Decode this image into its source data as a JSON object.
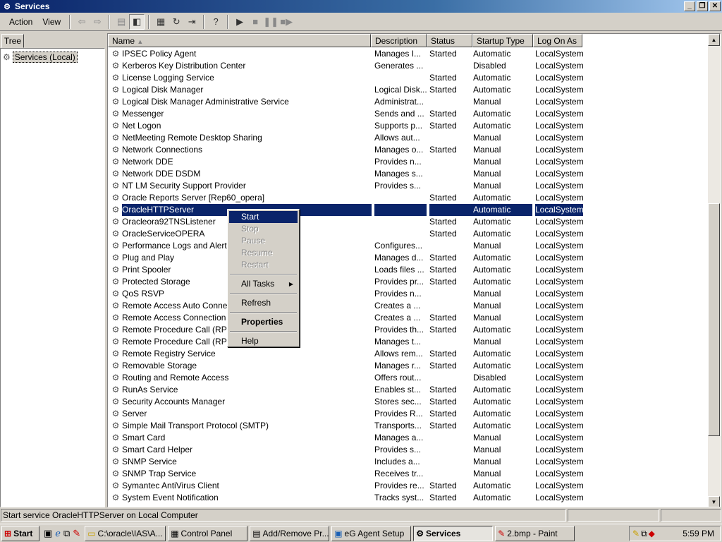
{
  "window": {
    "title": "Services"
  },
  "menubar": {
    "items": [
      {
        "label": "Action"
      },
      {
        "label": "View"
      }
    ]
  },
  "tree": {
    "tab_label": "Tree",
    "root_label": "Services (Local)"
  },
  "list": {
    "columns": [
      "Name",
      "Description",
      "Status",
      "Startup Type",
      "Log On As"
    ],
    "rows": [
      {
        "name": "IPSEC Policy Agent",
        "desc": "Manages I...",
        "status": "Started",
        "type": "Automatic",
        "logon": "LocalSystem"
      },
      {
        "name": "Kerberos Key Distribution Center",
        "desc": "Generates ...",
        "status": "",
        "type": "Disabled",
        "logon": "LocalSystem"
      },
      {
        "name": "License Logging Service",
        "desc": "",
        "status": "Started",
        "type": "Automatic",
        "logon": "LocalSystem"
      },
      {
        "name": "Logical Disk Manager",
        "desc": "Logical Disk...",
        "status": "Started",
        "type": "Automatic",
        "logon": "LocalSystem"
      },
      {
        "name": "Logical Disk Manager Administrative Service",
        "desc": "Administrat...",
        "status": "",
        "type": "Manual",
        "logon": "LocalSystem"
      },
      {
        "name": "Messenger",
        "desc": "Sends and ...",
        "status": "Started",
        "type": "Automatic",
        "logon": "LocalSystem"
      },
      {
        "name": "Net Logon",
        "desc": "Supports p...",
        "status": "Started",
        "type": "Automatic",
        "logon": "LocalSystem"
      },
      {
        "name": "NetMeeting Remote Desktop Sharing",
        "desc": "Allows aut...",
        "status": "",
        "type": "Manual",
        "logon": "LocalSystem"
      },
      {
        "name": "Network Connections",
        "desc": "Manages o...",
        "status": "Started",
        "type": "Manual",
        "logon": "LocalSystem"
      },
      {
        "name": "Network DDE",
        "desc": "Provides n...",
        "status": "",
        "type": "Manual",
        "logon": "LocalSystem"
      },
      {
        "name": "Network DDE DSDM",
        "desc": "Manages s...",
        "status": "",
        "type": "Manual",
        "logon": "LocalSystem"
      },
      {
        "name": "NT LM Security Support Provider",
        "desc": "Provides s...",
        "status": "",
        "type": "Manual",
        "logon": "LocalSystem"
      },
      {
        "name": "Oracle Reports Server [Rep60_opera]",
        "desc": "",
        "status": "Started",
        "type": "Automatic",
        "logon": "LocalSystem"
      },
      {
        "name": "OracleHTTPServer",
        "desc": "",
        "status": "",
        "type": "Automatic",
        "logon": "LocalSystem",
        "selected": true
      },
      {
        "name": "Oracleora92TNSListener",
        "desc": "",
        "status": "Started",
        "type": "Automatic",
        "logon": "LocalSystem"
      },
      {
        "name": "OracleServiceOPERA",
        "desc": "",
        "status": "Started",
        "type": "Automatic",
        "logon": "LocalSystem"
      },
      {
        "name": "Performance Logs and Alerts",
        "desc": "Configures...",
        "status": "",
        "type": "Manual",
        "logon": "LocalSystem"
      },
      {
        "name": "Plug and Play",
        "desc": "Manages d...",
        "status": "Started",
        "type": "Automatic",
        "logon": "LocalSystem"
      },
      {
        "name": "Print Spooler",
        "desc": "Loads files ...",
        "status": "Started",
        "type": "Automatic",
        "logon": "LocalSystem"
      },
      {
        "name": "Protected Storage",
        "desc": "Provides pr...",
        "status": "Started",
        "type": "Automatic",
        "logon": "LocalSystem"
      },
      {
        "name": "QoS RSVP",
        "desc": "Provides n...",
        "status": "",
        "type": "Manual",
        "logon": "LocalSystem"
      },
      {
        "name": "Remote Access Auto Connection Manager",
        "desc": "Creates a ...",
        "status": "",
        "type": "Manual",
        "logon": "LocalSystem"
      },
      {
        "name": "Remote Access Connection Manager",
        "desc": "Creates a ...",
        "status": "Started",
        "type": "Manual",
        "logon": "LocalSystem"
      },
      {
        "name": "Remote Procedure Call (RPC)",
        "desc": "Provides th...",
        "status": "Started",
        "type": "Automatic",
        "logon": "LocalSystem"
      },
      {
        "name": "Remote Procedure Call (RPC) Locator",
        "desc": "Manages t...",
        "status": "",
        "type": "Manual",
        "logon": "LocalSystem"
      },
      {
        "name": "Remote Registry Service",
        "desc": "Allows rem...",
        "status": "Started",
        "type": "Automatic",
        "logon": "LocalSystem"
      },
      {
        "name": "Removable Storage",
        "desc": "Manages r...",
        "status": "Started",
        "type": "Automatic",
        "logon": "LocalSystem"
      },
      {
        "name": "Routing and Remote Access",
        "desc": "Offers rout...",
        "status": "",
        "type": "Disabled",
        "logon": "LocalSystem"
      },
      {
        "name": "RunAs Service",
        "desc": "Enables st...",
        "status": "Started",
        "type": "Automatic",
        "logon": "LocalSystem"
      },
      {
        "name": "Security Accounts Manager",
        "desc": "Stores sec...",
        "status": "Started",
        "type": "Automatic",
        "logon": "LocalSystem"
      },
      {
        "name": "Server",
        "desc": "Provides R...",
        "status": "Started",
        "type": "Automatic",
        "logon": "LocalSystem"
      },
      {
        "name": "Simple Mail Transport Protocol (SMTP)",
        "desc": "Transports...",
        "status": "Started",
        "type": "Automatic",
        "logon": "LocalSystem"
      },
      {
        "name": "Smart Card",
        "desc": "Manages a...",
        "status": "",
        "type": "Manual",
        "logon": "LocalSystem"
      },
      {
        "name": "Smart Card Helper",
        "desc": "Provides s...",
        "status": "",
        "type": "Manual",
        "logon": "LocalSystem"
      },
      {
        "name": "SNMP Service",
        "desc": "Includes a...",
        "status": "",
        "type": "Manual",
        "logon": "LocalSystem"
      },
      {
        "name": "SNMP Trap Service",
        "desc": "Receives tr...",
        "status": "",
        "type": "Manual",
        "logon": "LocalSystem"
      },
      {
        "name": "Symantec AntiVirus Client",
        "desc": "Provides re...",
        "status": "Started",
        "type": "Automatic",
        "logon": "LocalSystem"
      },
      {
        "name": "System Event Notification",
        "desc": "Tracks syst...",
        "status": "Started",
        "type": "Automatic",
        "logon": "LocalSystem"
      }
    ]
  },
  "context_menu": {
    "start": "Start",
    "stop": "Stop",
    "pause": "Pause",
    "resume": "Resume",
    "restart": "Restart",
    "all_tasks": "All Tasks",
    "refresh": "Refresh",
    "properties": "Properties",
    "help": "Help"
  },
  "statusbar": {
    "text": "Start service OracleHTTPServer on Local Computer"
  },
  "taskbar": {
    "start_label": "Start",
    "tasks": [
      {
        "label": "C:\\oracle\\IAS\\A...",
        "icon": "folder-icon"
      },
      {
        "label": "Control Panel",
        "icon": "control-panel-icon"
      },
      {
        "label": "Add/Remove Pr...",
        "icon": "add-remove-icon"
      },
      {
        "label": "eG Agent Setup",
        "icon": "setup-icon"
      },
      {
        "label": "Services",
        "icon": "services-icon",
        "active": true
      },
      {
        "label": "2.bmp - Paint",
        "icon": "paint-icon"
      }
    ],
    "clock": "5:59 PM"
  }
}
